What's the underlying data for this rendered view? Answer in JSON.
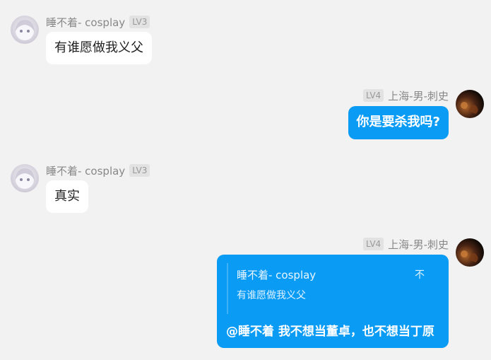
{
  "messages": [
    {
      "user": "睡不着- cosplay",
      "level": "LV3",
      "text": "有谁愿做我义父"
    },
    {
      "user": "上海-男-刺史",
      "level": "LV4",
      "text": "你是要杀我吗?"
    },
    {
      "user": "睡不着- cosplay",
      "level": "LV3",
      "text": "真实"
    },
    {
      "user": "上海-男-刺史",
      "level": "LV4",
      "quote": {
        "author": "睡不着- cosplay",
        "text": "有谁愿做我义父",
        "close_label": "不"
      },
      "text": "@睡不着 我不想当董卓，也不想当丁原"
    }
  ],
  "colors": {
    "background": "#f2f2f2",
    "bubble_blue": "#0a9bf5",
    "bubble_white": "#ffffff"
  },
  "icons": {
    "left_avatar": "anime-girl-avatar",
    "right_avatar": "dark-portrait-avatar"
  }
}
